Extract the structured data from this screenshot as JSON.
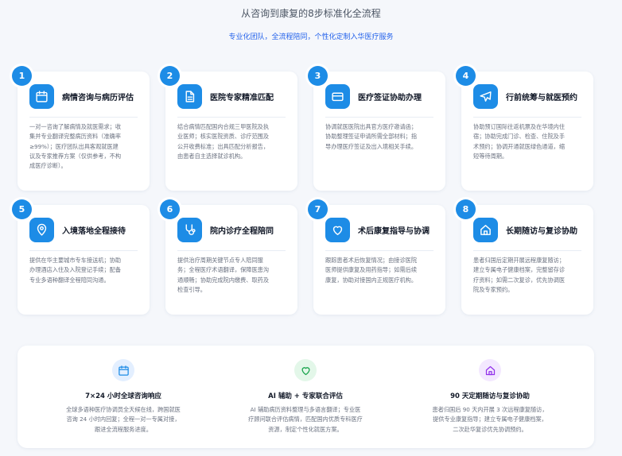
{
  "header": {
    "title": "从咨询到康复的8步标准化全流程",
    "subtitle": "专业化团队，全流程陪同，个性化定制入华医疗服务"
  },
  "steps": [
    {
      "number": "1",
      "icon": "calendar-icon",
      "title": "病情咨询与病历评估",
      "lines": [
        "一对一咨询了解病情及就医需求；收",
        "集并专业翻译完整病历资料（准确率",
        "≥99%）；医疗团队出具客观就医建",
        "议及专家推荐方案（仅供参考，不构",
        "成医疗诊断）。"
      ]
    },
    {
      "number": "2",
      "icon": "document-icon",
      "title": "医院专家精准匹配",
      "lines": [
        "结合病情匹配国内合规三甲医院及执",
        "业医师；核实医院资质、诊疗范围及",
        "公开收费标准；出具匹配分析报告，",
        "由患者自主选择就诊机构。"
      ]
    },
    {
      "number": "3",
      "icon": "credit-card-icon",
      "title": "医疗签证协助办理",
      "lines": [
        "协调就医医院出具官方医疗邀请函；",
        "协助整理签证申请所需全部材料；指",
        "导办理医疗签证及出入境相关手续。"
      ]
    },
    {
      "number": "4",
      "icon": "airplane-icon",
      "title": "行前统筹与就医预约",
      "lines": [
        "协助预订国际往返机票及在华境内住",
        "宿；协助完成门诊、检查、住院及手",
        "术预约；协调开通就医绿色通道，缩",
        "短等待周期。"
      ]
    },
    {
      "number": "5",
      "icon": "location-pin-icon",
      "title": "入境落地全程接待",
      "lines": [
        "提供在华主要城市专车接送机；协助",
        "办理酒店入住及入院登记手续；配备",
        "专业多语种翻译全程陪同沟通。"
      ]
    },
    {
      "number": "6",
      "icon": "stethoscope-icon",
      "title": "院内诊疗全程陪同",
      "lines": [
        "提供治疗周期关键节点专人陪同服",
        "务；全程医疗术语翻译，保障医患沟",
        "通顺畅；协助完成院内缴费、取药及",
        "检查引导。"
      ]
    },
    {
      "number": "7",
      "icon": "heart-icon",
      "title": "术后康复指导与协调",
      "lines": [
        "跟踪患者术后恢复情况；由接诊医院",
        "医师提供康复及用药指导；如需后续",
        "康复，协助对接国内正规医疗机构。"
      ]
    },
    {
      "number": "8",
      "icon": "home-icon",
      "title": "长期随访与复诊协助",
      "lines": [
        "患者归国后定期开展远程康复随访；",
        "建立专属电子健康档案，完整留存诊",
        "疗资料；如需二次复诊，优先协调医",
        "院及专家预约。"
      ]
    }
  ],
  "features": [
    {
      "icon": "calendar-icon",
      "icon_color": "#1d8ce6",
      "icon_bg": "#e3efff",
      "title": "7×24 小时全球咨询响应",
      "lines": [
        "全球多语种医疗协调员全天候在线，跨国就医",
        "咨询 24 小时内回复；全程一对一专属对接，",
        "跟进全流程服务进度。"
      ]
    },
    {
      "icon": "heart-icon",
      "icon_color": "#16a34a",
      "icon_bg": "#e3f7e9",
      "title": "AI 辅助 + 专家联合评估",
      "lines": [
        "AI 辅助病历资料整理与多语言翻译；专业医",
        "疗顾问联合评估病情，匹配国内优质专科医疗",
        "资源，制定个性化就医方案。"
      ]
    },
    {
      "icon": "home-icon",
      "icon_color": "#9333ea",
      "icon_bg": "#f3e8ff",
      "title": "90 天定期随访与复诊协助",
      "lines": [
        "患者归国后 90 天内开展 3 次远程康复随访，",
        "提供专业康复指导；建立专属电子健康档案，",
        "二次赴华复诊优先协调预约。"
      ]
    }
  ],
  "colors": {
    "accent": "#1d8ce6",
    "link": "#2563eb",
    "text_muted": "#6b7280"
  }
}
